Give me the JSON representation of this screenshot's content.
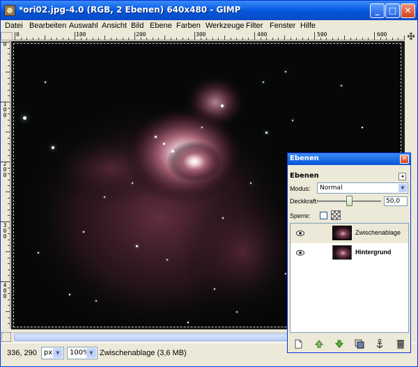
{
  "window": {
    "title": "*ori02.jpg-4.0 (RGB, 2 Ebenen) 640x480 - GIMP",
    "minimize": "_",
    "maximize": "□",
    "close": "✕"
  },
  "menubar": {
    "items": [
      "Datei",
      "Bearbeiten",
      "Auswahl",
      "Ansicht",
      "Bild",
      "Ebene",
      "Farben",
      "Werkzeuge",
      "Filter",
      "Fenster",
      "Hilfe"
    ]
  },
  "ruler": {
    "h_labels": [
      "0",
      "100",
      "200",
      "300",
      "400",
      "500",
      "600"
    ],
    "v_labels": [
      "0",
      "100",
      "200",
      "300",
      "400"
    ]
  },
  "statusbar": {
    "coords": "336, 290",
    "unit": "px",
    "zoom": "100%",
    "message": "Zwischenablage (3,6 MB)"
  },
  "layers_dock": {
    "title": "Ebenen",
    "tab_heading": "Ebenen",
    "mode_label": "Modus:",
    "mode_value": "Normal",
    "opacity_label": "Deckkraft:",
    "opacity_value": "50,0",
    "opacity_fraction": 0.5,
    "lock_label": "Sperre:",
    "layers": [
      {
        "name": "Zwischenablage",
        "selected": true,
        "visible": true
      },
      {
        "name": "Hintergrund",
        "selected": false,
        "visible": true
      }
    ],
    "toolbar_icons": [
      "new-layer-icon",
      "raise-layer-icon",
      "lower-layer-icon",
      "duplicate-layer-icon",
      "anchor-layer-icon",
      "delete-layer-icon"
    ]
  },
  "colors": {
    "titlebar": "#0a5ee8",
    "canvas_bg": "#060808",
    "nebula": "#7b3e55"
  }
}
